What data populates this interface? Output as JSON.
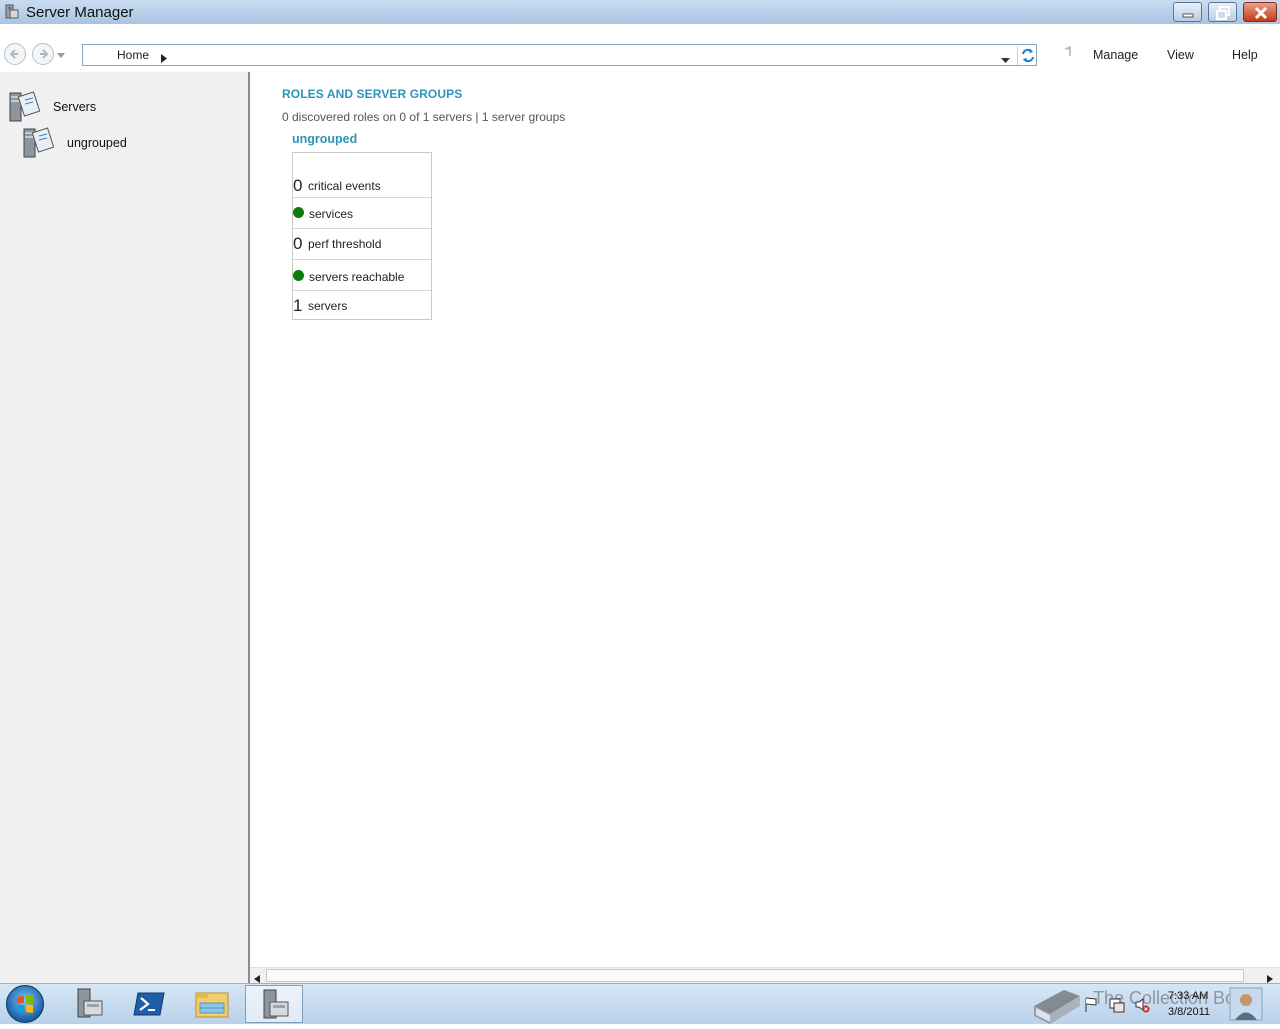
{
  "window": {
    "title": "Server Manager"
  },
  "toolbar": {
    "breadcrumb": "Home",
    "menus": {
      "manage": "Manage",
      "view": "View",
      "help": "Help"
    }
  },
  "sidebar": {
    "items": [
      {
        "label": "Servers"
      },
      {
        "label": "ungrouped"
      }
    ]
  },
  "main": {
    "section_title": "ROLES AND SERVER GROUPS",
    "subtitle": "0 discovered roles on 0 of 1 servers | 1 server groups",
    "group": {
      "title": "ungrouped",
      "rows": [
        {
          "count": "0",
          "label": "critical events",
          "status": ""
        },
        {
          "count": "",
          "label": "services",
          "status": "ok"
        },
        {
          "count": "0",
          "label": "perf threshold",
          "status": ""
        },
        {
          "count": "",
          "label": "servers reachable",
          "status": "ok"
        },
        {
          "count": "1",
          "label": "servers",
          "status": ""
        }
      ]
    }
  },
  "taskbar": {
    "clock_time": "7:33 AM",
    "clock_date": "3/8/2011",
    "watermark": "The Collection Book"
  },
  "colors": {
    "accent": "#2b95b8",
    "status_ok": "#0a7a0a",
    "titlebar": "#a9c5e3"
  }
}
